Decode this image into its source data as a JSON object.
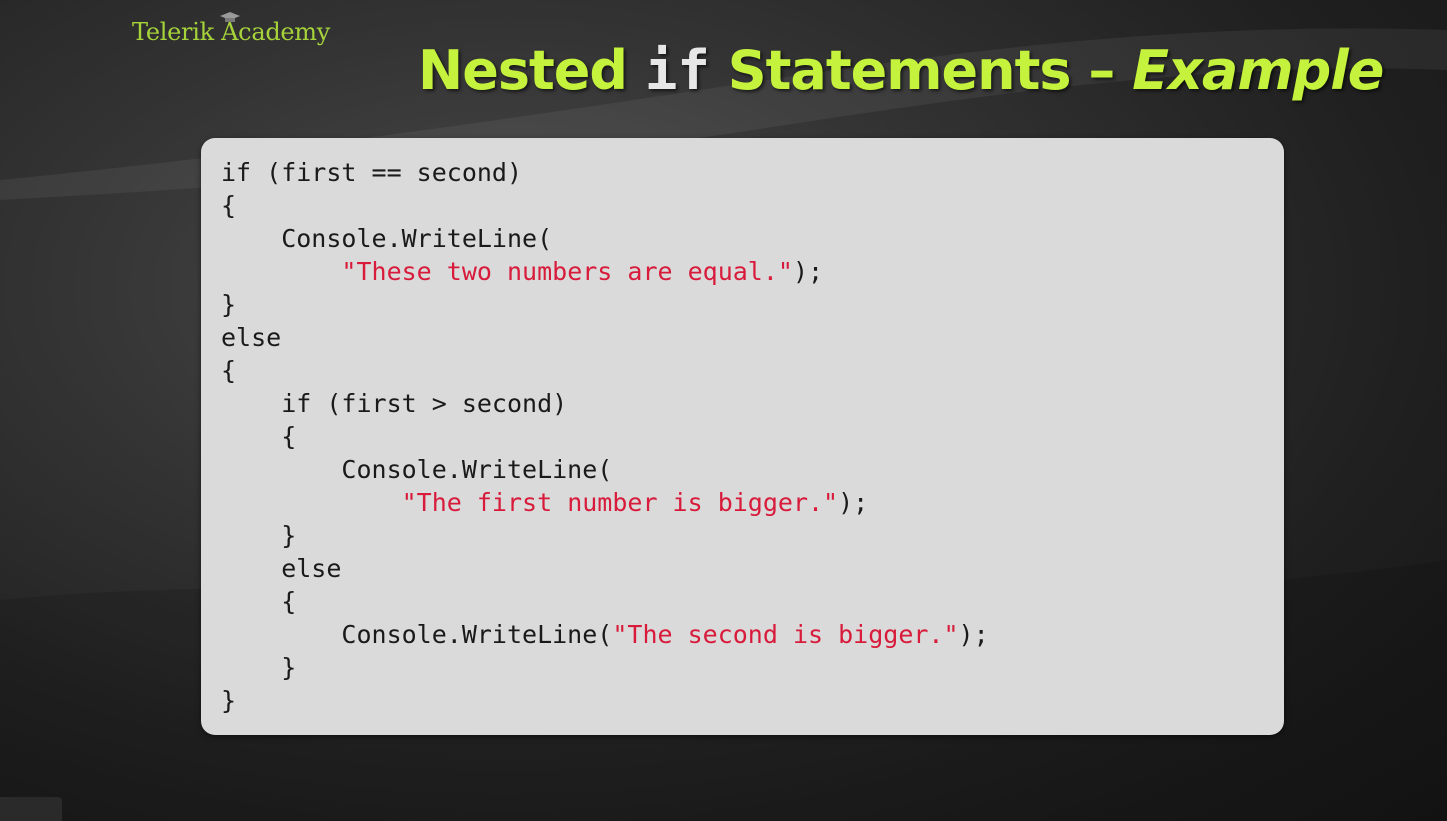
{
  "logo": {
    "text": "Telerik Academy"
  },
  "title": {
    "part1": "Nested ",
    "keyword": "if",
    "part2": " Statements – ",
    "emphasis": "Example"
  },
  "colors": {
    "title": "#c5f23c",
    "logo": "#a6d23a",
    "string_literal": "#d81b3b",
    "code_background": "#dadada"
  },
  "code": {
    "lines": [
      {
        "pre": "if (first == second)",
        "str": "",
        "post": ""
      },
      {
        "pre": "{",
        "str": "",
        "post": ""
      },
      {
        "pre": "    Console.WriteLine(",
        "str": "",
        "post": ""
      },
      {
        "pre": "        ",
        "str": "\"These two numbers are equal.\"",
        "post": ");"
      },
      {
        "pre": "}",
        "str": "",
        "post": ""
      },
      {
        "pre": "else",
        "str": "",
        "post": ""
      },
      {
        "pre": "{",
        "str": "",
        "post": ""
      },
      {
        "pre": "    if (first > second)",
        "str": "",
        "post": ""
      },
      {
        "pre": "    {",
        "str": "",
        "post": ""
      },
      {
        "pre": "        Console.WriteLine(",
        "str": "",
        "post": ""
      },
      {
        "pre": "            ",
        "str": "\"The first number is bigger.\"",
        "post": ");"
      },
      {
        "pre": "    }",
        "str": "",
        "post": ""
      },
      {
        "pre": "    else",
        "str": "",
        "post": ""
      },
      {
        "pre": "    {",
        "str": "",
        "post": ""
      },
      {
        "pre": "        Console.WriteLine(",
        "str": "\"The second is bigger.\"",
        "post": ");"
      },
      {
        "pre": "    }",
        "str": "",
        "post": ""
      },
      {
        "pre": "}",
        "str": "",
        "post": ""
      }
    ]
  }
}
